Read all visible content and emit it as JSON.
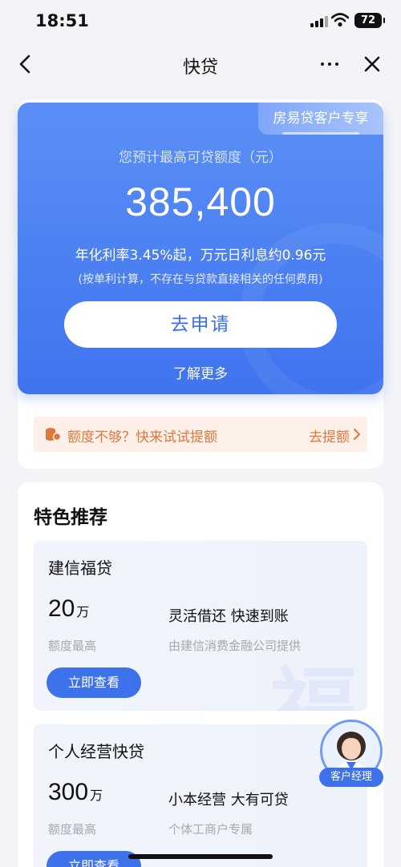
{
  "status_bar": {
    "time": "18:51",
    "battery": "72"
  },
  "nav": {
    "title": "快贷"
  },
  "hero": {
    "badge": "房易贷客户专享",
    "quota_label": "您预计最高可贷额度（元）",
    "quota_amount": "385,400",
    "rate_text": "年化利率3.45%起，万元日利息约0.96元",
    "rate_note": "(按单利计算，不存在与贷款直接相关的任何费用)",
    "apply_label": "去申请",
    "learn_more": "了解更多"
  },
  "increase_banner": {
    "text": "额度不够？快来试试提额",
    "link": "去提额"
  },
  "featured": {
    "title": "特色推荐",
    "products": [
      {
        "name": "建信福贷",
        "amount": "20",
        "unit": "万",
        "amount_label": "额度最高",
        "slogan": "灵活借还 快速到账",
        "provider": "由建信消费金融公司提供",
        "button": "立即查看",
        "watermark": "福"
      },
      {
        "name": "个人经营快贷",
        "amount": "300",
        "unit": "万",
        "amount_label": "额度最高",
        "slogan": "小本经营 大有可贷",
        "provider": "个体工商户专属",
        "button": "立即查看",
        "watermark": ""
      }
    ]
  },
  "manager": {
    "label": "客户经理"
  },
  "colors": {
    "brand_blue": "#3e72ea",
    "warning_orange": "#e0773d",
    "banner_bg": "#fdf0e9"
  },
  "icons": [
    "signal-icon",
    "wifi-icon",
    "battery-icon",
    "back-icon",
    "more-icon",
    "close-icon",
    "coin-icon",
    "chevron-right-icon",
    "manager-avatar-icon"
  ]
}
